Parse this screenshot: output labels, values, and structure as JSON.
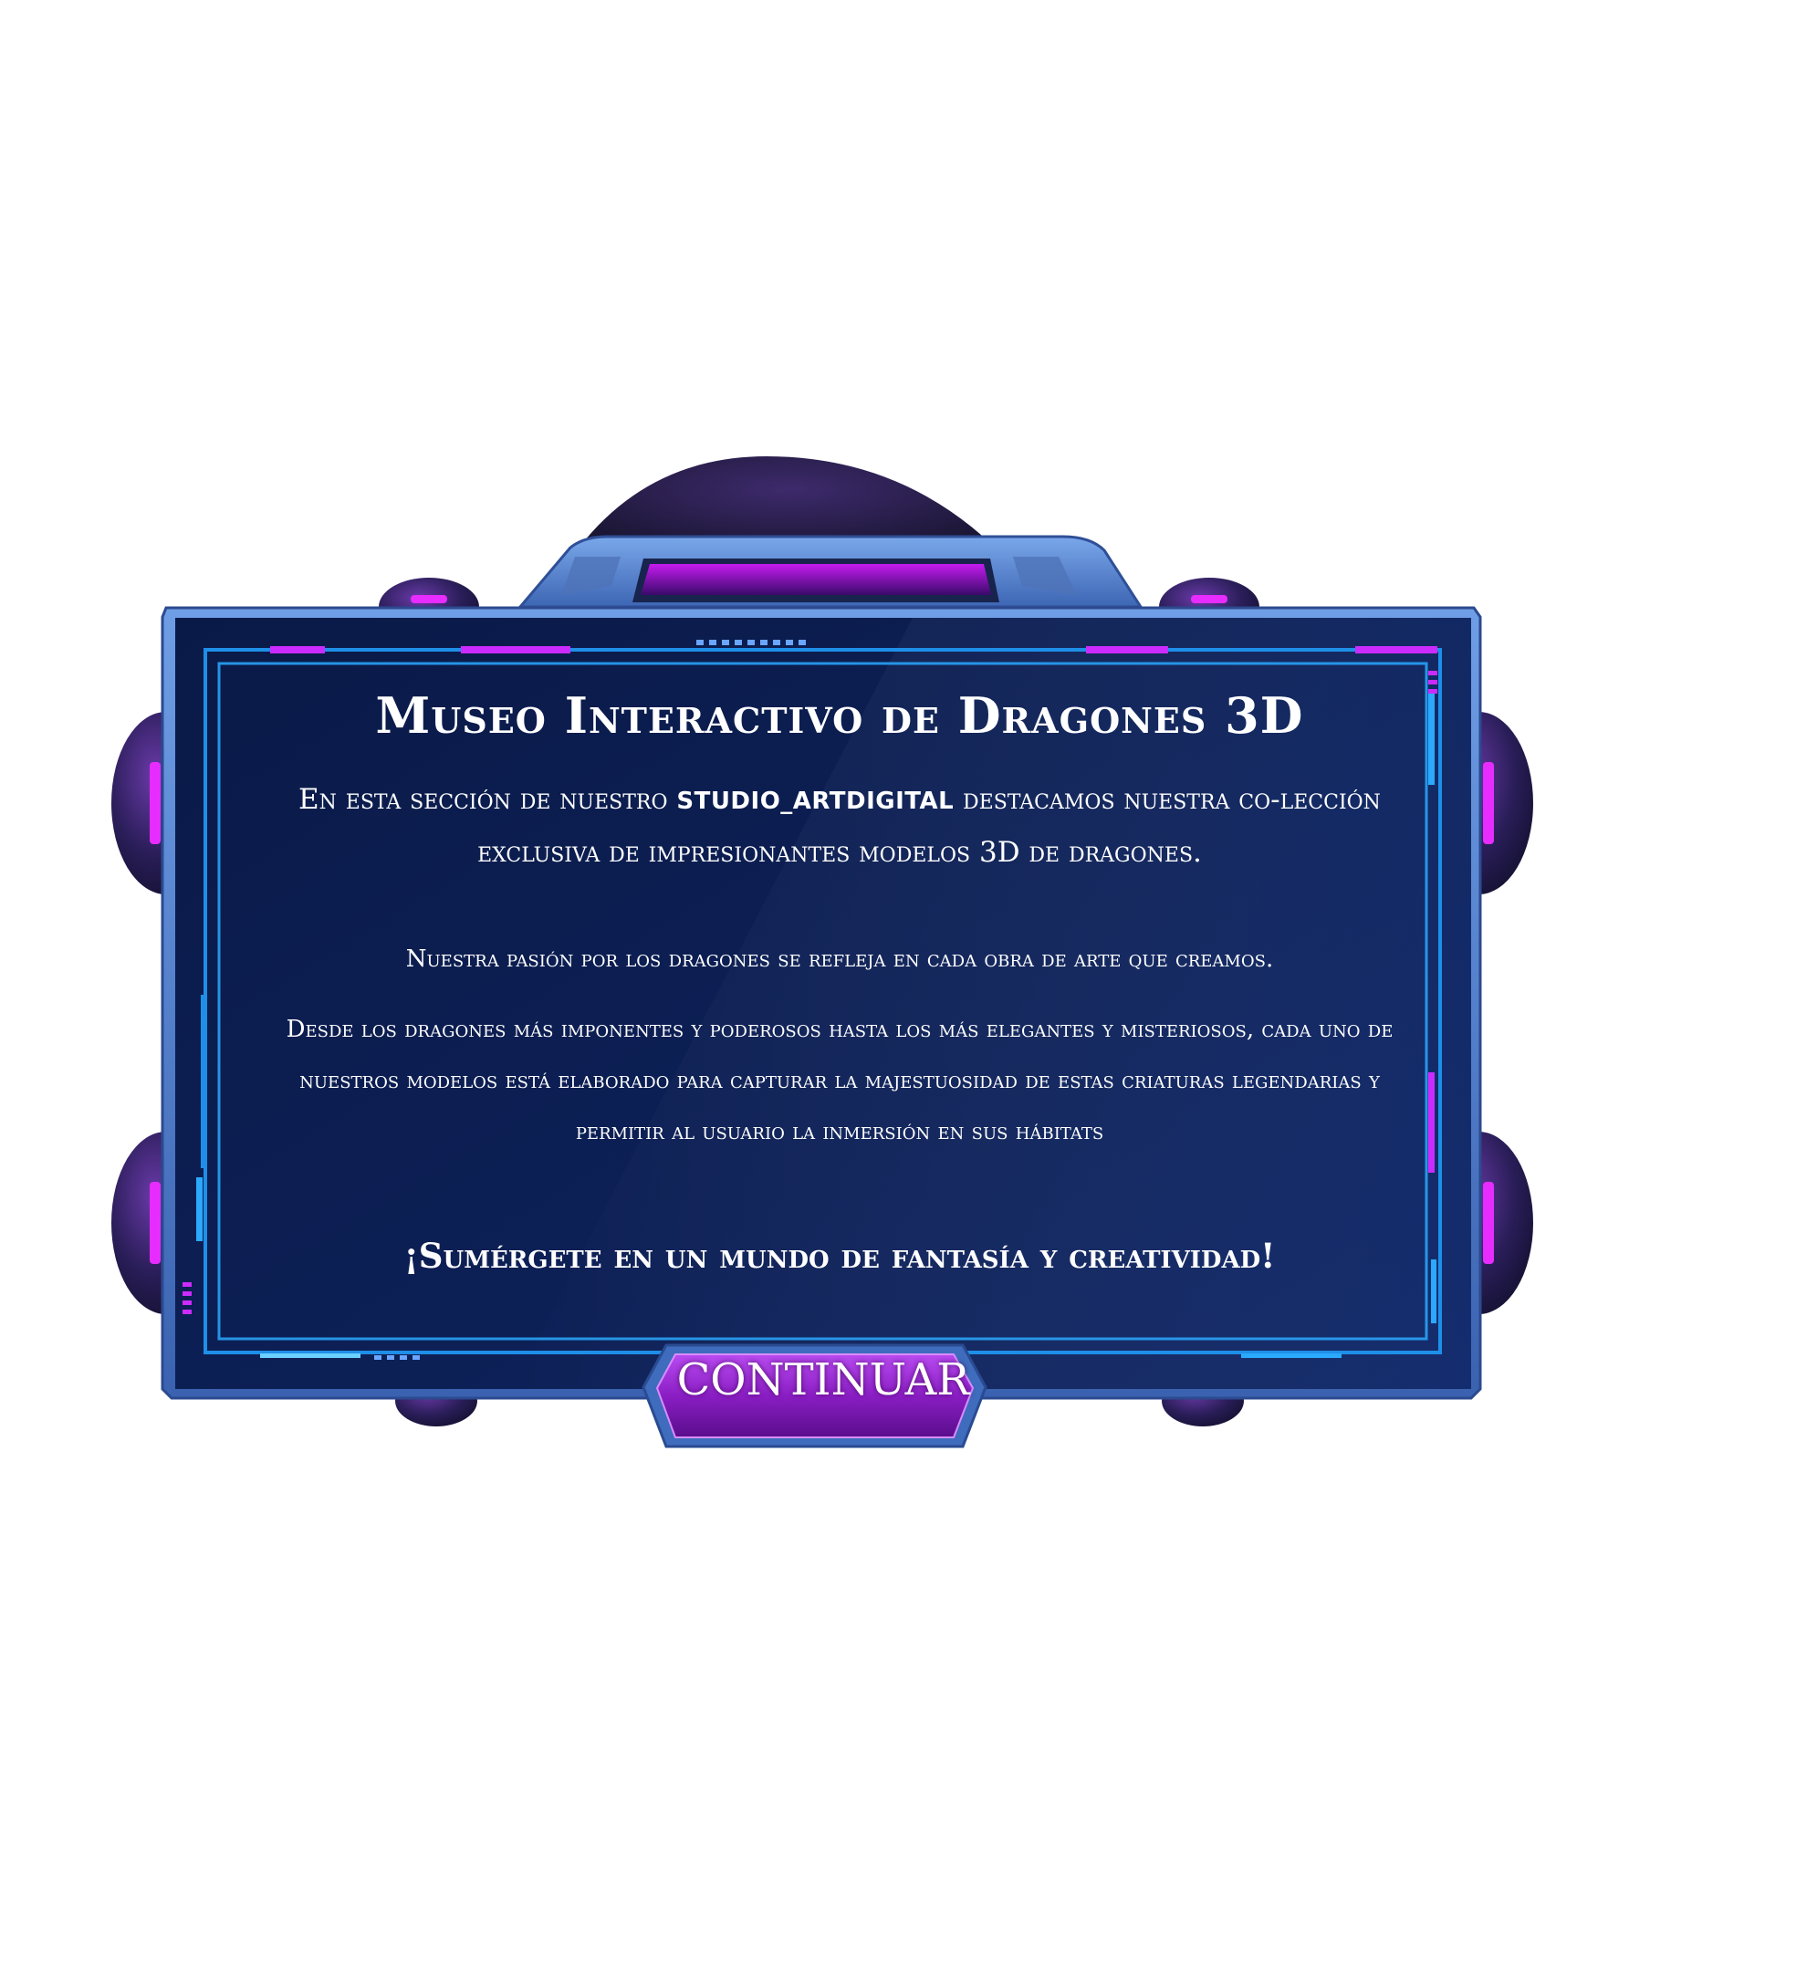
{
  "dialog": {
    "title": "Museo Interactivo de Dragones 3D",
    "intro_before": "En esta sección de nuestro ",
    "intro_brand": "studio_artdigital",
    "intro_after": " destacamos nuestra co-lección exclusiva de impresionantes modelos 3D de dragones.",
    "passion": "Nuestra pasión por los dragones se refleja en cada obra de arte que creamos.",
    "description": "Desde los dragones más imponentes y poderosos hasta los más elegantes y misteriosos, cada uno de nuestros modelos está elaborado para capturar la majestuosidad de estas criaturas legendarias y permitir al usuario la inmersión en sus hábitats",
    "tagline": "¡Sumérgete en un mundo de fantasía y creatividad!",
    "continue_label": "CONTINUAR"
  },
  "colors": {
    "panel_dark": "#0b1c4e",
    "panel_mid": "#122a6b",
    "frame_blue": "#4a7fd0",
    "neon_blue": "#1ea8ff",
    "neon_purple": "#d21dff",
    "button_purple": "#8e1fc7",
    "dome_dark": "#1c1738"
  }
}
